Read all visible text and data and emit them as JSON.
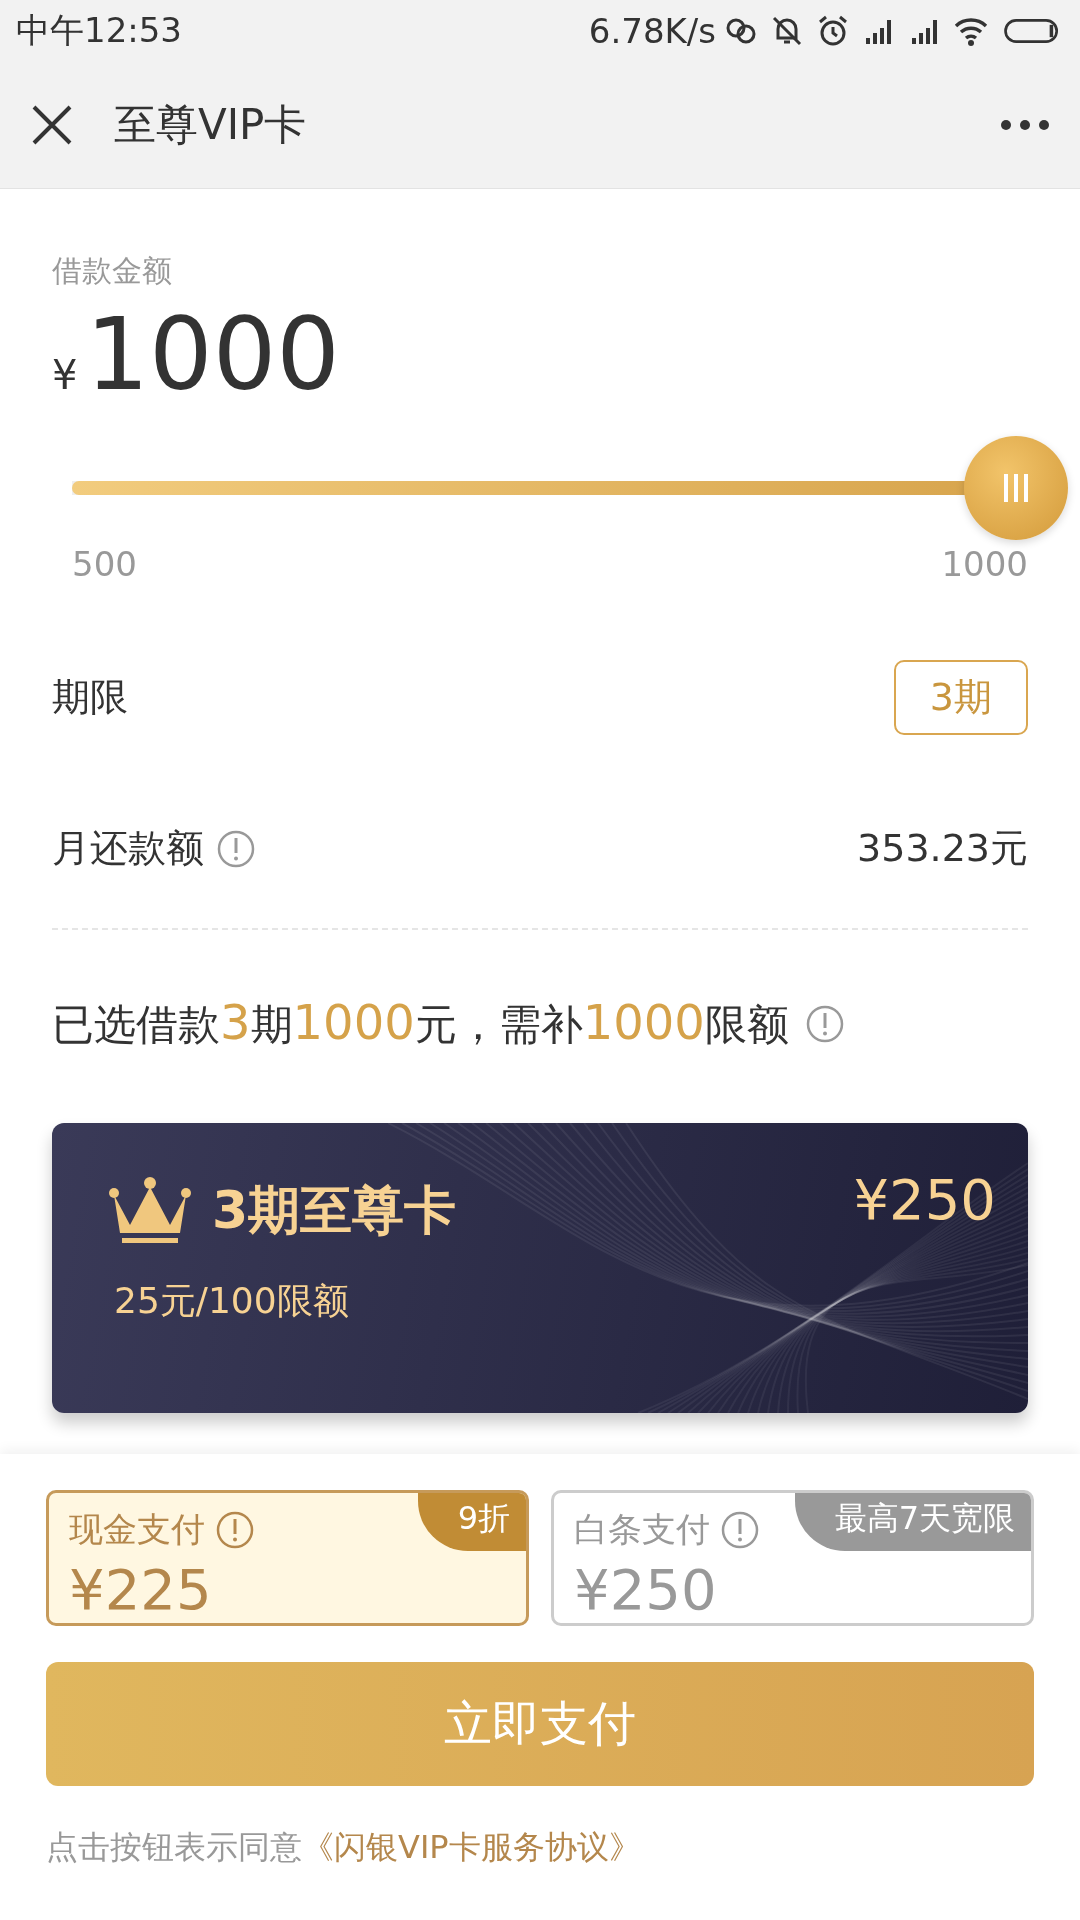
{
  "status_bar": {
    "time": "中午12:53",
    "speed": "6.78K/s"
  },
  "header": {
    "title": "至尊VIP卡"
  },
  "loan": {
    "label": "借款金额",
    "currency": "¥",
    "amount": "1000",
    "slider": {
      "level": 1.0,
      "min_label": "500",
      "max_label": "1000"
    }
  },
  "term": {
    "label": "期限",
    "value": "3期"
  },
  "monthly": {
    "label": "月还款额",
    "value": "353.23元"
  },
  "summary": [
    {
      "text": "已选借款",
      "highlight": false
    },
    {
      "text": "3",
      "highlight": true
    },
    {
      "text": "期",
      "highlight": false
    },
    {
      "text": "1000",
      "highlight": true
    },
    {
      "text": "元，需补",
      "highlight": false
    },
    {
      "text": "1000",
      "highlight": true
    },
    {
      "text": "限额",
      "highlight": false
    }
  ],
  "card": {
    "title": "3期至尊卡",
    "price": "¥250",
    "subtitle": "25元/100限额"
  },
  "payment_options": [
    {
      "label": "现金支付",
      "amount": "¥225",
      "badge": "9折",
      "selected": true
    },
    {
      "label": "白条支付",
      "amount": "¥250",
      "badge": "最高7天宽限",
      "selected": false
    }
  ],
  "pay_button": "立即支付",
  "agreement": {
    "text": "点击按钮表示同意",
    "link": "《闪银VIP卡服务协议》"
  }
}
